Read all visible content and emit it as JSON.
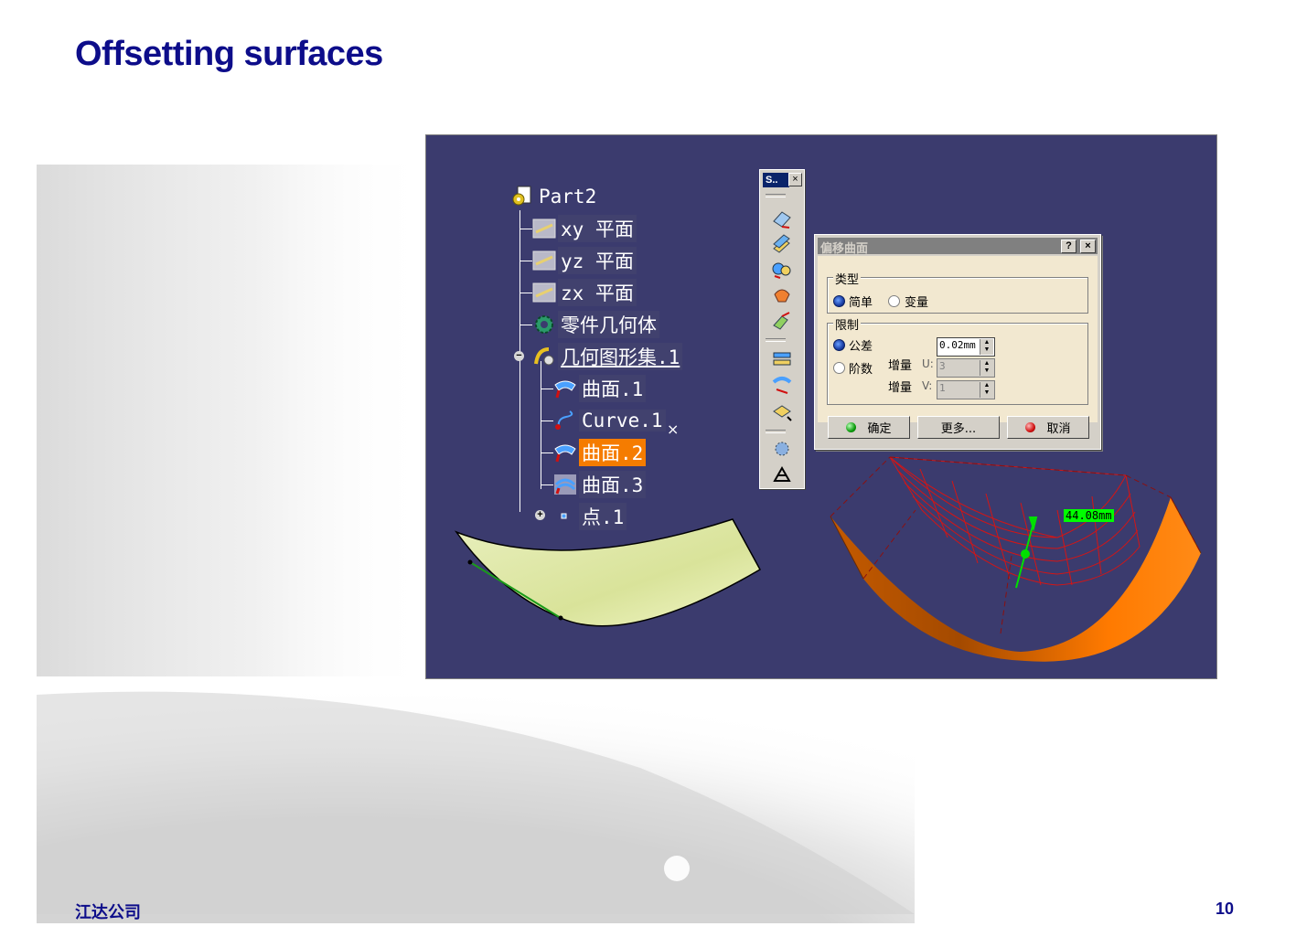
{
  "slide": {
    "title": "Offsetting surfaces",
    "footer_left": "江达公司",
    "page_number": "10"
  },
  "tree": {
    "items": [
      {
        "label": "Part2",
        "icon": "part-icon"
      },
      {
        "label": "xy 平面",
        "icon": "plane-icon"
      },
      {
        "label": "yz 平面",
        "icon": "plane-icon"
      },
      {
        "label": "zx 平面",
        "icon": "plane-icon"
      },
      {
        "label": "零件几何体",
        "icon": "body-gear-icon"
      },
      {
        "label": "几何图形集.1",
        "icon": "geometrical-set-icon"
      },
      {
        "label": "曲面.1",
        "icon": "surface-icon"
      },
      {
        "label": "Curve.1",
        "icon": "curve-icon"
      },
      {
        "label": "曲面.2",
        "icon": "surface-icon"
      },
      {
        "label": "曲面.3",
        "icon": "offset-surface-icon"
      },
      {
        "label": "点.1",
        "icon": "point-icon"
      }
    ],
    "selected": "曲面.2",
    "stray_mark": "×"
  },
  "toolbar": {
    "title": "S..",
    "close": "×",
    "icons": [
      "extrude-icon",
      "offset-icon",
      "sweep-icon",
      "fill-icon",
      "blend-icon",
      "join-icon",
      "split-icon",
      "transform-icon",
      "law-icon",
      "axis-icon"
    ]
  },
  "dialog": {
    "title": "偏移曲面",
    "help_button": "?",
    "close_button": "×",
    "type_group": {
      "label": "类型",
      "options": [
        "简单",
        "变量"
      ],
      "selected": "简单"
    },
    "limit_group": {
      "label": "限制",
      "tolerance_label": "公差",
      "order_label": "阶数",
      "selected": "公差",
      "tolerance_value": "0.02mm",
      "increment_u_label": "增量",
      "u_axis": "U:",
      "u_value": "3",
      "increment_v_label": "增量",
      "v_axis": "V:",
      "v_value": "1"
    },
    "buttons": {
      "ok": "确定",
      "more": "更多...",
      "cancel": "取消"
    }
  },
  "viewport": {
    "dimension_label": "44.08mm",
    "background_color": "#3b3b6e",
    "highlight_color": "#f57c00",
    "dimension_color": "#00ff00"
  }
}
